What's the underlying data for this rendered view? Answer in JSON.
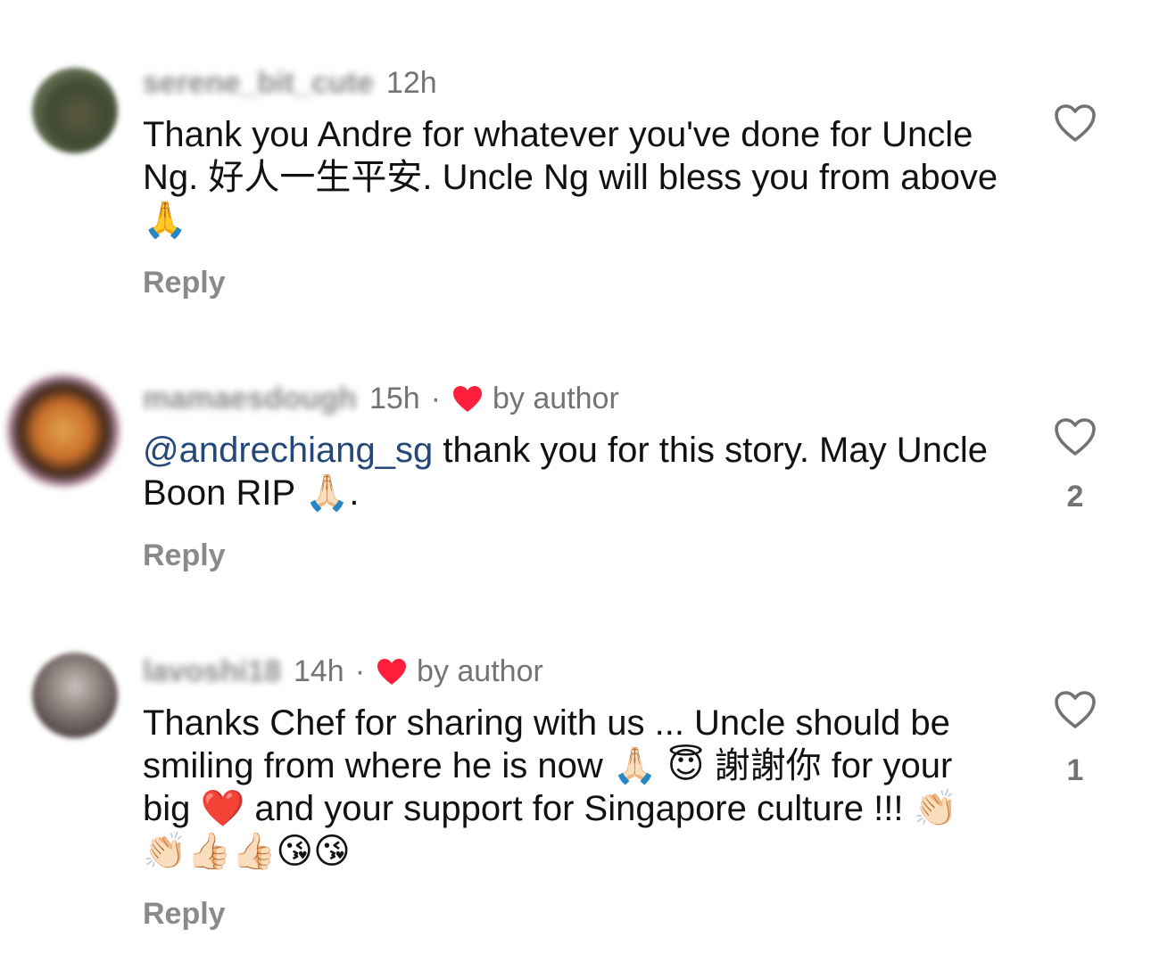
{
  "comments": [
    {
      "username": "serene_bit_cute",
      "time": "12h",
      "liked_by_author": false,
      "author_label": "",
      "text_parts": [
        "Thank you Andre for whatever you've done for Uncle Ng. 好人一生平安. Uncle Ng will bless you from above 🙏"
      ],
      "reply_label": "Reply",
      "like_count": ""
    },
    {
      "username": "mamaesdough",
      "time": "15h",
      "liked_by_author": true,
      "author_label": "by author",
      "mention": "@andrechiang_sg",
      "text_parts": [
        " thank you for this story. May Uncle Boon RIP 🙏🏻."
      ],
      "reply_label": "Reply",
      "like_count": "2"
    },
    {
      "username": "lavoshi18",
      "time": "14h",
      "liked_by_author": true,
      "author_label": "by author",
      "text_parts": [
        "Thanks Chef for sharing with us ... Uncle should be smiling from where he is now 🙏🏻 😇  謝謝你 for your big ❤️ and your support for Singapore culture !!! 👏🏻👏🏻👍🏻👍🏻😘😘"
      ],
      "reply_label": "Reply",
      "like_count": "1"
    }
  ],
  "colors": {
    "text": "#111111",
    "meta": "#737373",
    "mention": "#24487a",
    "heart": "#ff1e3c"
  },
  "icons": {
    "like": "heart-outline-icon",
    "author_like": "heart-filled-icon"
  }
}
